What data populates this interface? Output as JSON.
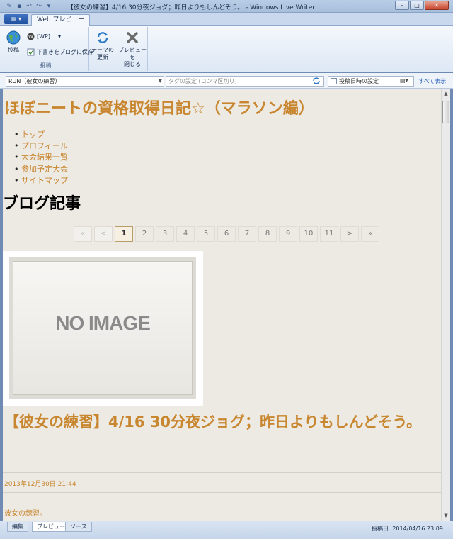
{
  "window": {
    "title": "【彼女の練習】4/16 30分夜ジョグ；昨日よりもしんどそう。 - Windows Live Writer",
    "controls": [
      "–",
      "□",
      "✕"
    ]
  },
  "ribbon": {
    "active_tab": "Web プレビュー",
    "publish_label": "投稿",
    "blog_account_label": "[WP]…",
    "save_draft_label": "下書きをブログに保存",
    "publish_group_label": "投稿",
    "refresh_theme_label": "テーマの\n更新",
    "close_preview_label": "プレビューを\n閉じる"
  },
  "toolbar": {
    "category": "RUN（彼女の練習）",
    "tags_placeholder": "タグの設定 (コンマ区切り)",
    "set_date_label": "投稿日時の設定",
    "show_all_label": "すべて表示"
  },
  "preview": {
    "blog_title": "ほぼニートの資格取得日記☆（マラソン編）",
    "nav": [
      "トップ",
      "プロフィール",
      "大会結果一覧",
      "参加予定大会",
      "サイトマップ"
    ],
    "section_heading": "ブログ記事",
    "pager": [
      "«",
      "<",
      "1",
      "2",
      "3",
      "4",
      "5",
      "6",
      "7",
      "8",
      "9",
      "10",
      "11",
      ">",
      "»"
    ],
    "pager_active": "1",
    "no_image_text": "NO IMAGE",
    "post_title": "【彼女の練習】4/16 30分夜ジョグ；昨日よりもしんどそう。",
    "post_date": "2013年12月30日 21:44",
    "excerpt": "彼女の練習。"
  },
  "bottom": {
    "tabs": [
      "編集",
      "プレビュー",
      "ソース"
    ],
    "active_tab": "プレビュー",
    "status": "投稿日: 2014/04/16 23:09"
  },
  "colors": {
    "accent": "#c8862f",
    "preview_bg": "#ede9e3",
    "ribbon_bg": "#dde8f5"
  }
}
